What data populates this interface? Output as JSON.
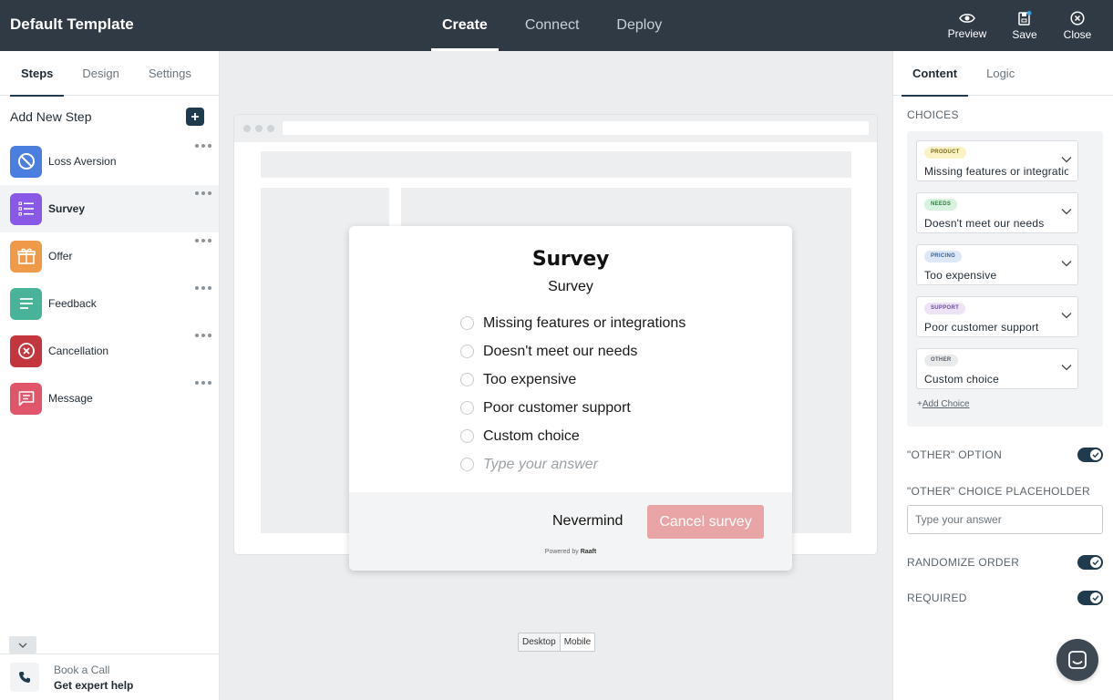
{
  "header": {
    "title": "Default Template",
    "tabs": [
      {
        "label": "Create",
        "active": true
      },
      {
        "label": "Connect",
        "active": false
      },
      {
        "label": "Deploy",
        "active": false
      }
    ],
    "actions": {
      "preview": "Preview",
      "save": "Save",
      "close": "Close"
    }
  },
  "left_panel": {
    "tabs": [
      {
        "label": "Steps",
        "active": true
      },
      {
        "label": "Design",
        "active": false
      },
      {
        "label": "Settings",
        "active": false
      }
    ],
    "add_step_label": "Add New Step",
    "steps": [
      {
        "label": "Loss Aversion",
        "icon": "block-icon",
        "color": "#4a7fe0"
      },
      {
        "label": "Survey",
        "icon": "list-icon",
        "color": "#8a58e6",
        "active": true
      },
      {
        "label": "Offer",
        "icon": "gift-icon",
        "color": "#ef9a48"
      },
      {
        "label": "Feedback",
        "icon": "lines-icon",
        "color": "#49b39a"
      },
      {
        "label": "Cancellation",
        "icon": "x-circle-icon",
        "color": "#c4363d"
      },
      {
        "label": "Message",
        "icon": "message-icon",
        "color": "#e0556a"
      }
    ],
    "book_call": {
      "title": "Book a Call",
      "subtitle": "Get expert help"
    }
  },
  "canvas": {
    "modal": {
      "title": "Survey",
      "subtitle": "Survey",
      "options": [
        "Missing features or integrations",
        "Doesn't meet our needs",
        "Too expensive",
        "Poor customer support",
        "Custom choice"
      ],
      "other_placeholder": "Type your answer",
      "nevermind_label": "Nevermind",
      "cancel_label": "Cancel survey",
      "powered_prefix": "Powered by",
      "powered_brand": "Raaft",
      "cancel_color": "#e9a5a5"
    },
    "device_toggle": {
      "desktop": "Desktop",
      "mobile": "Mobile",
      "active": "Desktop"
    }
  },
  "right_panel": {
    "tabs": [
      {
        "label": "Content",
        "active": true
      },
      {
        "label": "Logic",
        "active": false
      }
    ],
    "choices_label": "CHOICES",
    "choices": [
      {
        "tag": "PRODUCT",
        "text": "Missing features or integrations",
        "tag_bg": "#fbf3c5",
        "tag_color": "#7a6a1a"
      },
      {
        "tag": "NEEDS",
        "text": "Doesn't meet our needs",
        "tag_bg": "#d7f2dd",
        "tag_color": "#2f7a43"
      },
      {
        "tag": "PRICING",
        "text": "Too expensive",
        "tag_bg": "#dde8f7",
        "tag_color": "#3b5f8f"
      },
      {
        "tag": "SUPPORT",
        "text": "Poor customer support",
        "tag_bg": "#ece3f7",
        "tag_color": "#6a4b91"
      },
      {
        "tag": "OTHER",
        "text": "Custom choice",
        "tag_bg": "#e8eaec",
        "tag_color": "#555d63"
      }
    ],
    "add_choice_label": "Add Choice",
    "other_option_label": "\"OTHER\" OPTION",
    "other_option_on": true,
    "other_placeholder_label": "\"OTHER\" CHOICE PLACEHOLDER",
    "other_placeholder_value": "Type your answer",
    "randomize_label": "RANDOMIZE ORDER",
    "randomize_on": true,
    "required_label": "REQUIRED",
    "required_on": true
  },
  "colors": {
    "topbar": "#2f3a45",
    "accent": "#1f3b4d"
  }
}
